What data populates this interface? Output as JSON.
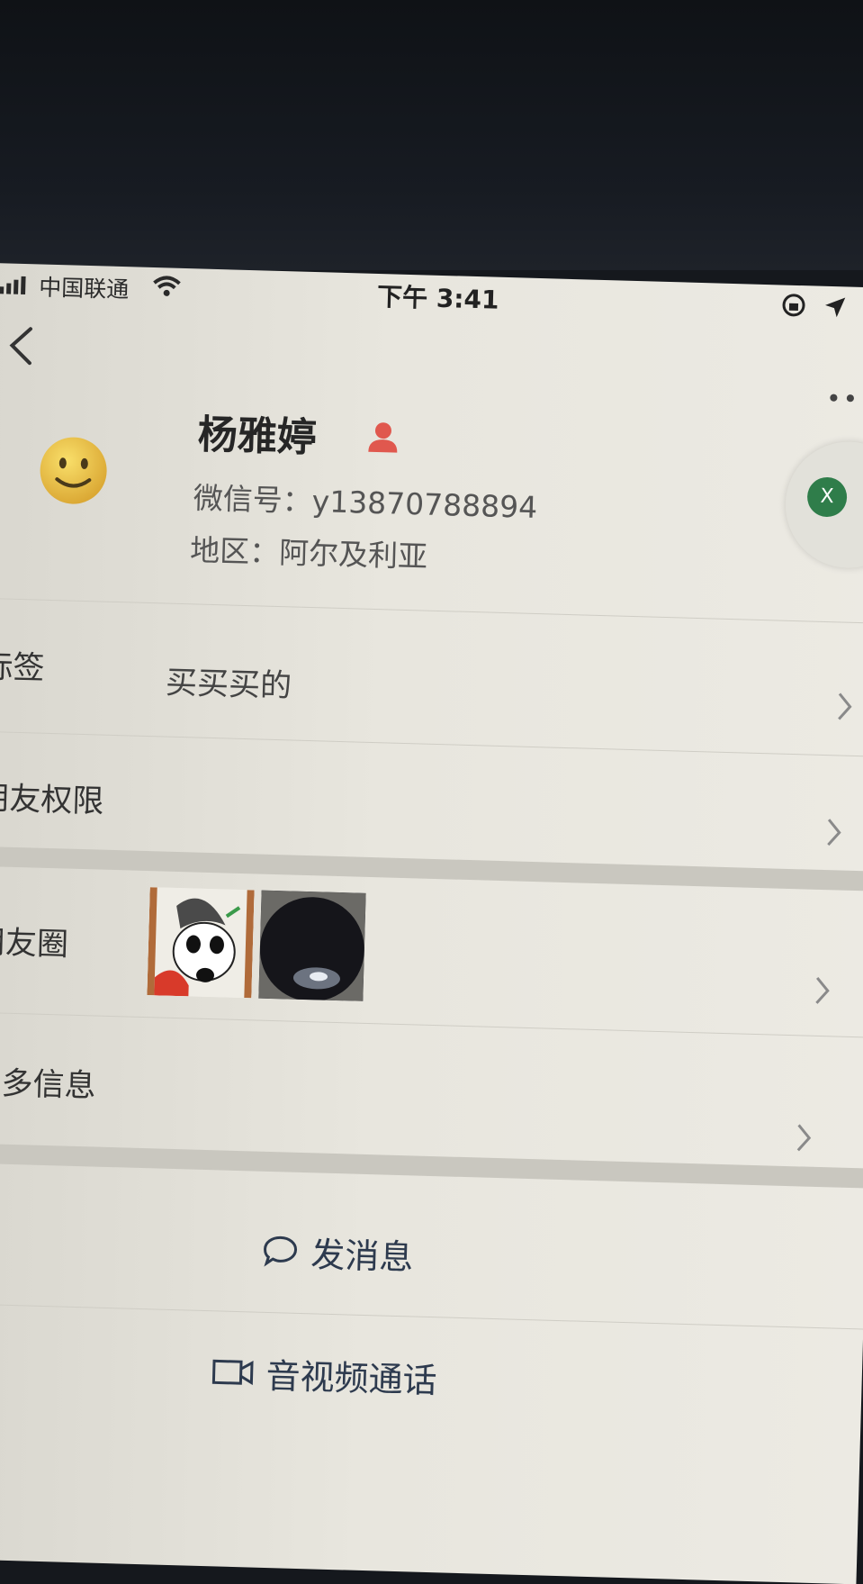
{
  "status_bar": {
    "carrier": "中国联通",
    "time": "下午 3:41"
  },
  "profile": {
    "name": "杨雅婷",
    "wechat_id": "微信号：y13870788894",
    "region": "地区：阿尔及利亚"
  },
  "floating_bubble": {
    "label": "X"
  },
  "rows": [
    {
      "label": "标签",
      "value": "买买买的"
    },
    {
      "label": "朋友权限",
      "value": ""
    },
    {
      "label": "朋友圈",
      "value": ""
    },
    {
      "label": "更多信息",
      "value": ""
    }
  ],
  "actions": {
    "message": "发消息",
    "call": "音视频通话"
  },
  "colors": {
    "badge": "#e0584e",
    "link": "#2d3a4e",
    "bubble_green": "#2f7d4a"
  }
}
